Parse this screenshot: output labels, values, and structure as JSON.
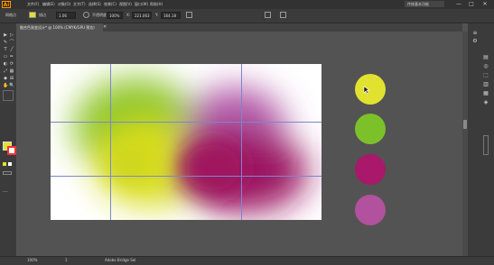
{
  "app": {
    "logo": "Ai",
    "workspace": "传统基本功能"
  },
  "menu": [
    "文件(F)",
    "编辑(E)",
    "对象(O)",
    "文字(T)",
    "选择(S)",
    "效果(C)",
    "视图(V)",
    "窗口(W)",
    "帮助(H)"
  ],
  "window_controls": {
    "minimize": "—",
    "maximize": "□",
    "close": "✕"
  },
  "control_bar": {
    "selection_label": "网格点",
    "stroke_label": "描边",
    "stroke_value": "1.06",
    "opacity_label": "不透明度",
    "opacity_value": "100%",
    "x_label": "X:",
    "x_value": "221.063",
    "y_label": "Y:",
    "y_value": "164.18"
  },
  "document_tab": {
    "title": "融合色渐变设计* @ 100% (CMYK/GPU 预览)",
    "close": "✕"
  },
  "status_bar": {
    "zoom": "100%",
    "page": "1",
    "status": "Adobe Bridge Sel"
  },
  "swatches": [
    {
      "name": "yellow",
      "color": "#e1e22f"
    },
    {
      "name": "green",
      "color": "#7cc12a"
    },
    {
      "name": "magenta",
      "color": "#a9186a"
    },
    {
      "name": "pink-purple",
      "color": "#b2519d"
    }
  ],
  "fill_swatch_color": "#e1e22f",
  "tools": [
    "▶",
    "▷",
    "✎",
    "⌒",
    "T",
    "╱",
    "▭",
    "✏",
    "◐",
    "⟳",
    "⤢",
    "▦",
    "◆",
    "⊞",
    "✋",
    "🔍"
  ],
  "right_icons": [
    "≡",
    "⚙",
    "▤",
    "◎",
    "⬚",
    "▥",
    "▦",
    "◈"
  ]
}
